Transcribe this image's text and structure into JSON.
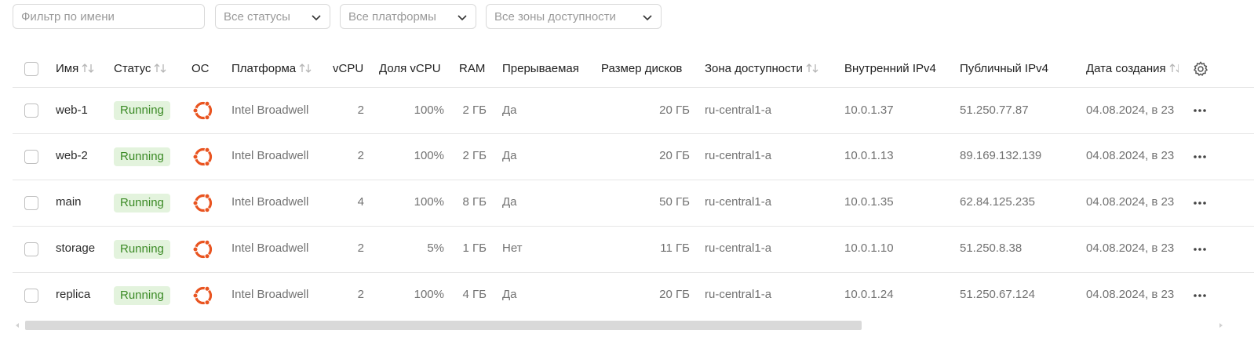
{
  "filters": {
    "name_placeholder": "Фильтр по имени",
    "status": "Все статусы",
    "platform": "Все платформы",
    "zone": "Все зоны доступности"
  },
  "columns": {
    "name": "Имя",
    "status": "Статус",
    "os": "ОС",
    "platform": "Платформа",
    "vcpu": "vCPU",
    "vcpu_share": "Доля vCPU",
    "ram": "RAM",
    "preemptible": "Прерываемая",
    "disk_size": "Размер дисков",
    "zone": "Зона доступности",
    "internal_ipv4": "Внутренний IPv4",
    "public_ipv4": "Публичный IPv4",
    "created": "Дата создания"
  },
  "rows": [
    {
      "name": "web-1",
      "status": "Running",
      "os_icon": "ubuntu-icon",
      "platform": "Intel Broadwell",
      "vcpu": "2",
      "vcpu_share": "100%",
      "ram": "2 ГБ",
      "preemptible": "Да",
      "disk_size": "20 ГБ",
      "zone": "ru-central1-a",
      "internal_ipv4": "10.0.1.37",
      "public_ipv4": "51.250.77.87",
      "created": "04.08.2024, в 23"
    },
    {
      "name": "web-2",
      "status": "Running",
      "os_icon": "ubuntu-icon",
      "platform": "Intel Broadwell",
      "vcpu": "2",
      "vcpu_share": "100%",
      "ram": "2 ГБ",
      "preemptible": "Да",
      "disk_size": "20 ГБ",
      "zone": "ru-central1-a",
      "internal_ipv4": "10.0.1.13",
      "public_ipv4": "89.169.132.139",
      "created": "04.08.2024, в 23"
    },
    {
      "name": "main",
      "status": "Running",
      "os_icon": "ubuntu-icon",
      "platform": "Intel Broadwell",
      "vcpu": "4",
      "vcpu_share": "100%",
      "ram": "8 ГБ",
      "preemptible": "Да",
      "disk_size": "50 ГБ",
      "zone": "ru-central1-a",
      "internal_ipv4": "10.0.1.35",
      "public_ipv4": "62.84.125.235",
      "created": "04.08.2024, в 23"
    },
    {
      "name": "storage",
      "status": "Running",
      "os_icon": "ubuntu-icon",
      "platform": "Intel Broadwell",
      "vcpu": "2",
      "vcpu_share": "5%",
      "ram": "1 ГБ",
      "preemptible": "Нет",
      "disk_size": "11 ГБ",
      "zone": "ru-central1-a",
      "internal_ipv4": "10.0.1.10",
      "public_ipv4": "51.250.8.38",
      "created": "04.08.2024, в 23"
    },
    {
      "name": "replica",
      "status": "Running",
      "os_icon": "ubuntu-icon",
      "platform": "Intel Broadwell",
      "vcpu": "2",
      "vcpu_share": "100%",
      "ram": "4 ГБ",
      "preemptible": "Да",
      "disk_size": "20 ГБ",
      "zone": "ru-central1-a",
      "internal_ipv4": "10.0.1.24",
      "public_ipv4": "51.250.67.124",
      "created": "04.08.2024, в 23"
    }
  ],
  "colors": {
    "status_running_bg": "#e3f3dd",
    "status_running_text": "#3b8a25",
    "ubuntu_orange": "#e95420"
  }
}
